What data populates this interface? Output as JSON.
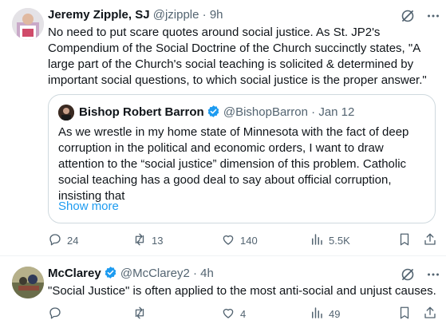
{
  "tweets": [
    {
      "author": {
        "name": "Jeremy Zipple, SJ",
        "handle": "@jzipple",
        "separator": "·",
        "time": "9h"
      },
      "text": "No need to put scare quotes around social justice. As St. JP2's Compendium of the Social Doctrine of the Church succinctly states, \"A large part of the Church's social teaching is solicited & determined by important social questions, to which social justice is the proper answer.\"",
      "quote": {
        "name": "Bishop Robert Barron",
        "handle": "@BishopBarron",
        "separator": "·",
        "time": "Jan 12",
        "text": "As we wrestle in my home state of Minnesota with the fact of deep corruption in the political and economic orders, I want to draw attention to the “social justice” dimension of this problem. Catholic social teaching has a good deal to say about official corruption, insisting that",
        "show_more": "Show more"
      },
      "stats": {
        "replies": "24",
        "reposts": "13",
        "likes": "140",
        "views": "5.5K"
      }
    },
    {
      "author": {
        "name": "McClarey",
        "handle": "@McClarey2",
        "separator": "·",
        "time": "4h"
      },
      "text": "\"Social Justice\" is often applied to the most anti-social and unjust causes.",
      "stats": {
        "replies": "",
        "reposts": "",
        "likes": "4",
        "views": "49"
      }
    }
  ],
  "colors": {
    "text": "#0f1419",
    "muted": "#536471",
    "link": "#1d9bf0",
    "border": "#cfd9de",
    "divider": "#eff3f4",
    "verified": "#1d9bf0"
  },
  "icons": [
    "grok-icon",
    "more-icon",
    "verified-icon",
    "reply-icon",
    "retweet-icon",
    "like-icon",
    "views-icon",
    "bookmark-icon",
    "share-icon"
  ]
}
